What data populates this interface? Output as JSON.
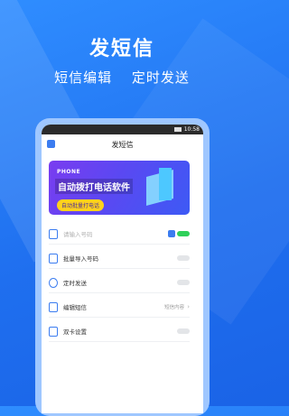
{
  "hero": {
    "title": "发短信",
    "sub1": "短信编辑",
    "sub2": "定时发送"
  },
  "status": {
    "time": "10:58"
  },
  "app": {
    "title": "发短信"
  },
  "banner": {
    "tag": "PHONE",
    "title": "自动拨打电话软件",
    "button": "自动批量打电话"
  },
  "rows": [
    {
      "label": "请输入号码"
    },
    {
      "label": "批量导入号码"
    },
    {
      "label": "定时发送"
    },
    {
      "label": "编辑短信",
      "extra": "短信内容"
    },
    {
      "label": "双卡设置"
    }
  ],
  "colors": {
    "bg": "#1f6fef",
    "accent": "#3b7cf0",
    "toggle_on": "#2fd05a"
  }
}
